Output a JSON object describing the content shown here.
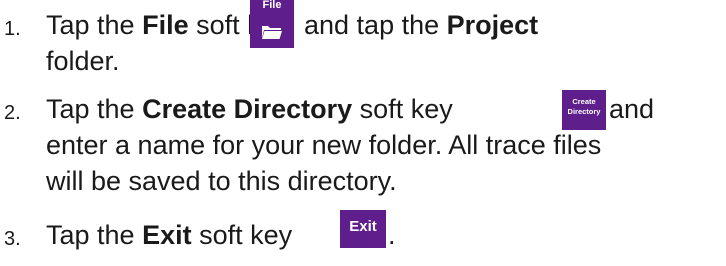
{
  "steps": [
    {
      "number": "1.",
      "before_key": "Tap the ",
      "bold1": "File",
      "after_bold1": " soft key",
      "after_key": "and tap the ",
      "bold2": "Project",
      "line2": "folder.",
      "key": {
        "label": "File",
        "icon": "folder-icon"
      }
    },
    {
      "number": "2.",
      "before_bold": "Tap the ",
      "bold": "Create Directory",
      "after_bold": " soft key",
      "after_key": "and",
      "line2": "enter a name for your new folder.  All trace files",
      "line3": "will be saved to this directory.",
      "key": {
        "label_line1": "Create",
        "label_line2": "Directory"
      }
    },
    {
      "number": "3.",
      "before_bold": "Tap the ",
      "bold": "Exit",
      "after_bold": " soft key",
      "after_key": ".",
      "key": {
        "label": "Exit"
      }
    }
  ],
  "colors": {
    "softkey_bg": "#5e1f8c",
    "softkey_text": "#ffffff",
    "body_text": "#1a1a1a"
  }
}
